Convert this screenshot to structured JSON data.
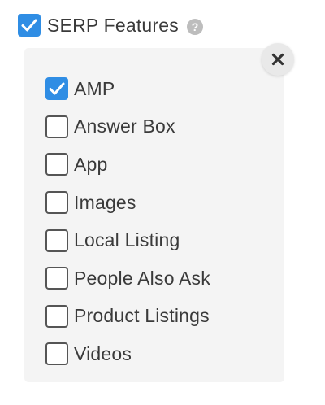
{
  "header": {
    "label": "SERP Features",
    "checked": true,
    "help_icon": "question-circle-icon"
  },
  "panel": {
    "close_icon": "close-icon",
    "options": [
      {
        "label": "AMP",
        "checked": true
      },
      {
        "label": "Answer Box",
        "checked": false
      },
      {
        "label": "App",
        "checked": false
      },
      {
        "label": "Images",
        "checked": false
      },
      {
        "label": "Local Listing",
        "checked": false
      },
      {
        "label": "People Also Ask",
        "checked": false
      },
      {
        "label": "Product Listings",
        "checked": false
      },
      {
        "label": "Videos",
        "checked": false
      }
    ]
  },
  "colors": {
    "accent": "#2f8de4",
    "panel_bg": "#f4f4f4",
    "text": "#3a3a3a"
  }
}
